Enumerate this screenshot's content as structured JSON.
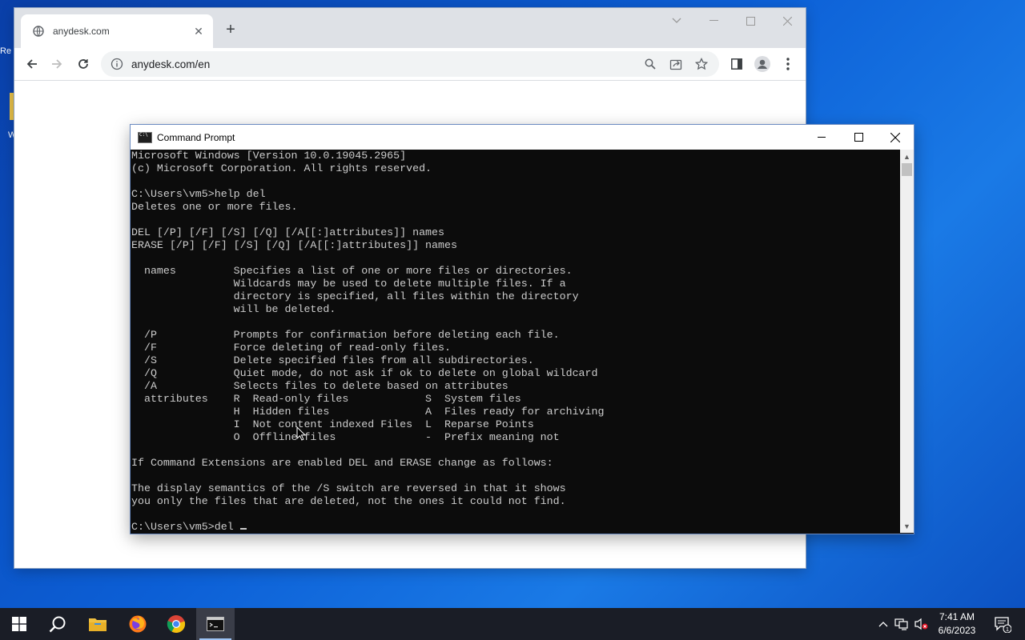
{
  "desktop": {
    "icon_fragment_1": "Re",
    "icon_fragment_2": "W"
  },
  "browser": {
    "tab_title": "anydesk.com",
    "new_tab_label": "+",
    "url": "anydesk.com/en"
  },
  "cmd": {
    "title": "Command Prompt",
    "lines": [
      "Microsoft Windows [Version 10.0.19045.2965]",
      "(c) Microsoft Corporation. All rights reserved.",
      "",
      "C:\\Users\\vm5>help del",
      "Deletes one or more files.",
      "",
      "DEL [/P] [/F] [/S] [/Q] [/A[[:]attributes]] names",
      "ERASE [/P] [/F] [/S] [/Q] [/A[[:]attributes]] names",
      "",
      "  names         Specifies a list of one or more files or directories.",
      "                Wildcards may be used to delete multiple files. If a",
      "                directory is specified, all files within the directory",
      "                will be deleted.",
      "",
      "  /P            Prompts for confirmation before deleting each file.",
      "  /F            Force deleting of read-only files.",
      "  /S            Delete specified files from all subdirectories.",
      "  /Q            Quiet mode, do not ask if ok to delete on global wildcard",
      "  /A            Selects files to delete based on attributes",
      "  attributes    R  Read-only files            S  System files",
      "                H  Hidden files               A  Files ready for archiving",
      "                I  Not content indexed Files  L  Reparse Points",
      "                O  Offline files              -  Prefix meaning not",
      "",
      "If Command Extensions are enabled DEL and ERASE change as follows:",
      "",
      "The display semantics of the /S switch are reversed in that it shows",
      "you only the files that are deleted, not the ones it could not find.",
      ""
    ],
    "prompt": "C:\\Users\\vm5>del "
  },
  "taskbar": {
    "time": "7:41 AM",
    "date": "6/6/2023",
    "notification_count": "1"
  },
  "colors": {
    "desktop_blue": "#0c5fd6",
    "taskbar": "#1a1d26",
    "console_bg": "#0c0c0c",
    "console_text": "#cccccc",
    "browser_tabbar": "#dee1e6"
  }
}
